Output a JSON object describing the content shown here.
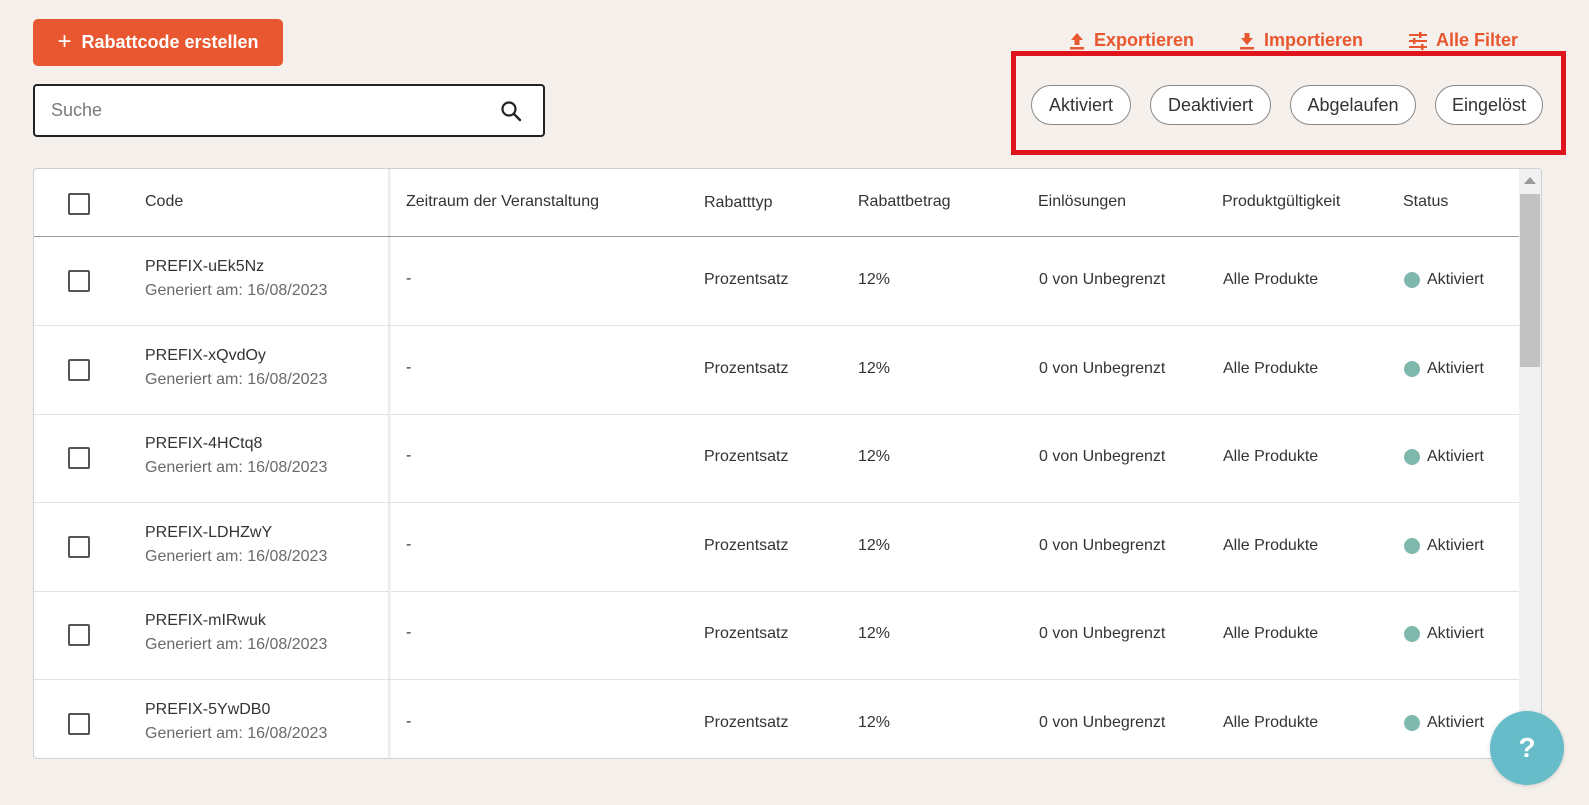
{
  "toolbar": {
    "create_label": "Rabattcode erstellen",
    "export_label": "Exportieren",
    "import_label": "Importieren",
    "filters_label": "Alle Filter"
  },
  "search": {
    "placeholder": "Suche",
    "value": ""
  },
  "status_filters": [
    "Aktiviert",
    "Deaktiviert",
    "Abgelaufen",
    "Eingelöst"
  ],
  "table": {
    "headers": {
      "code": "Code",
      "period": "Zeitraum der Veranstaltung",
      "type": "Rabatttyp",
      "amount": "Rabattbetrag",
      "redemptions": "Einlösungen",
      "validity": "Produktgültigkeit",
      "status": "Status"
    },
    "rows": [
      {
        "code": "PREFIX-uEk5Nz",
        "generated": "Generiert am: 16/08/2023",
        "period": "-",
        "type": "Prozentsatz",
        "amount": "12%",
        "redemptions": "0 von Unbegrenzt",
        "validity": "Alle Produkte",
        "status": "Aktiviert"
      },
      {
        "code": "PREFIX-xQvdOy",
        "generated": "Generiert am: 16/08/2023",
        "period": "-",
        "type": "Prozentsatz",
        "amount": "12%",
        "redemptions": "0 von Unbegrenzt",
        "validity": "Alle Produkte",
        "status": "Aktiviert"
      },
      {
        "code": "PREFIX-4HCtq8",
        "generated": "Generiert am: 16/08/2023",
        "period": "-",
        "type": "Prozentsatz",
        "amount": "12%",
        "redemptions": "0 von Unbegrenzt",
        "validity": "Alle Produkte",
        "status": "Aktiviert"
      },
      {
        "code": "PREFIX-LDHZwY",
        "generated": "Generiert am: 16/08/2023",
        "period": "-",
        "type": "Prozentsatz",
        "amount": "12%",
        "redemptions": "0 von Unbegrenzt",
        "validity": "Alle Produkte",
        "status": "Aktiviert"
      },
      {
        "code": "PREFIX-mIRwuk",
        "generated": "Generiert am: 16/08/2023",
        "period": "-",
        "type": "Prozentsatz",
        "amount": "12%",
        "redemptions": "0 von Unbegrenzt",
        "validity": "Alle Produkte",
        "status": "Aktiviert"
      },
      {
        "code": "PREFIX-5YwDB0",
        "generated": "Generiert am: 16/08/2023",
        "period": "-",
        "type": "Prozentsatz",
        "amount": "12%",
        "redemptions": "0 von Unbegrenzt",
        "validity": "Alle Produkte",
        "status": "Aktiviert"
      }
    ]
  },
  "help_label": "?",
  "colors": {
    "accent": "#e8572f",
    "status_active": "#7fb9ad",
    "highlight_frame": "#e0141d",
    "help": "#66bcc9"
  }
}
